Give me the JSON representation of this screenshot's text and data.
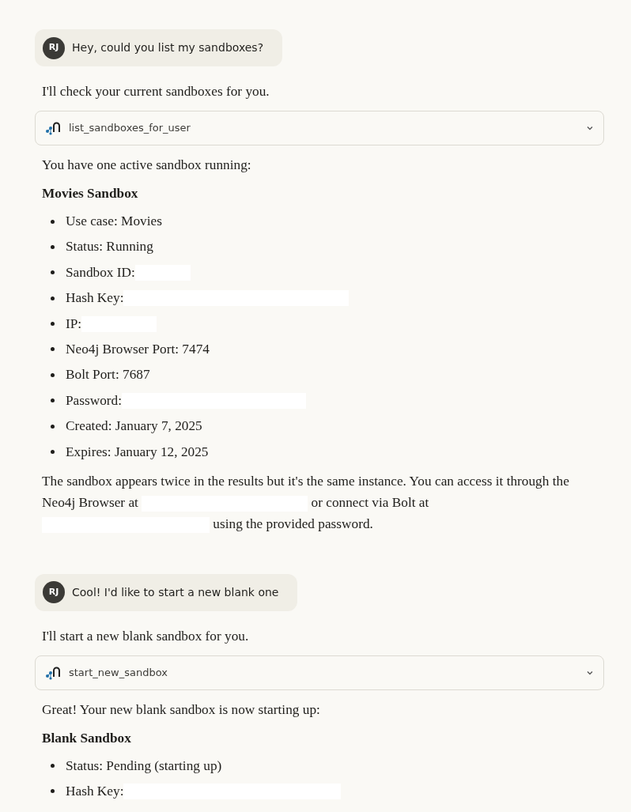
{
  "messages": [
    {
      "kind": "user",
      "avatar": "RJ",
      "text": "Hey, could you list my sandboxes?"
    },
    {
      "kind": "assistant",
      "parts": [
        {
          "kind": "paragraph",
          "segments": [
            {
              "kind": "text",
              "text": "I'll check your current sandboxes for you."
            }
          ]
        },
        {
          "kind": "tool",
          "name": "list_sandboxes_for_user",
          "expanded": false
        },
        {
          "kind": "paragraph",
          "segments": [
            {
              "kind": "text",
              "text": "You have one active sandbox running:"
            }
          ]
        },
        {
          "kind": "heading",
          "text": "Movies Sandbox"
        },
        {
          "kind": "bullets",
          "items": [
            {
              "segments": [
                {
                  "kind": "text",
                  "text": "Use case: Movies"
                }
              ]
            },
            {
              "segments": [
                {
                  "kind": "text",
                  "text": "Status: Running"
                }
              ]
            },
            {
              "segments": [
                {
                  "kind": "text",
                  "text": "Sandbox ID:"
                },
                {
                  "kind": "redacted"
                }
              ]
            },
            {
              "segments": [
                {
                  "kind": "text",
                  "text": "Hash Key:"
                },
                {
                  "kind": "redacted"
                }
              ]
            },
            {
              "segments": [
                {
                  "kind": "text",
                  "text": "IP:"
                },
                {
                  "kind": "redacted"
                }
              ]
            },
            {
              "segments": [
                {
                  "kind": "text",
                  "text": "Neo4j Browser Port: 7474"
                }
              ]
            },
            {
              "segments": [
                {
                  "kind": "text",
                  "text": "Bolt Port: 7687"
                }
              ]
            },
            {
              "segments": [
                {
                  "kind": "text",
                  "text": "Password:"
                },
                {
                  "kind": "redacted"
                }
              ]
            },
            {
              "segments": [
                {
                  "kind": "text",
                  "text": "Created: January 7, 2025"
                }
              ]
            },
            {
              "segments": [
                {
                  "kind": "text",
                  "text": "Expires: January 12, 2025"
                }
              ]
            }
          ]
        },
        {
          "kind": "paragraph",
          "segments": [
            {
              "kind": "text",
              "text": "The sandbox appears twice in the results but it's the same instance. You can access it through the Neo4j Browser at"
            },
            {
              "kind": "redacted"
            },
            {
              "kind": "text",
              "text": "or connect via Bolt at"
            },
            {
              "kind": "redacted"
            },
            {
              "kind": "text",
              "text": "using the provided password."
            }
          ]
        }
      ]
    },
    {
      "kind": "user",
      "avatar": "RJ",
      "text": "Cool! I'd like to start a new blank one"
    },
    {
      "kind": "assistant",
      "parts": [
        {
          "kind": "paragraph",
          "segments": [
            {
              "kind": "text",
              "text": "I'll start a new blank sandbox for you."
            }
          ]
        },
        {
          "kind": "tool",
          "name": "start_new_sandbox",
          "expanded": false
        },
        {
          "kind": "paragraph",
          "segments": [
            {
              "kind": "text",
              "text": "Great! Your new blank sandbox is now starting up:"
            }
          ]
        },
        {
          "kind": "heading",
          "text": "Blank Sandbox"
        },
        {
          "kind": "bullets",
          "items": [
            {
              "segments": [
                {
                  "kind": "text",
                  "text": "Status: Pending (starting up)"
                }
              ]
            },
            {
              "segments": [
                {
                  "kind": "text",
                  "text": "Hash Key:"
                },
                {
                  "kind": "redacted"
                }
              ]
            }
          ]
        }
      ]
    }
  ]
}
